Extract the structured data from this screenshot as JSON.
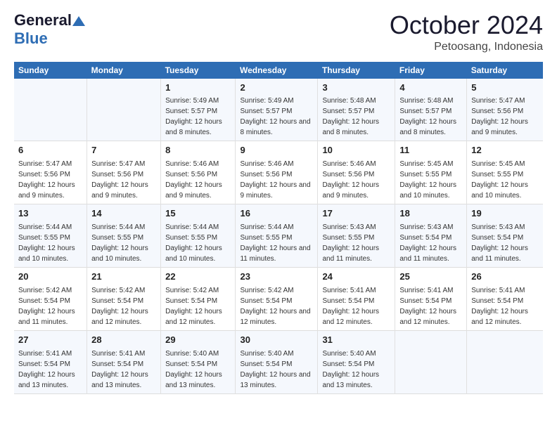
{
  "logo": {
    "general": "General",
    "blue": "Blue",
    "tagline": ""
  },
  "header": {
    "month": "October 2024",
    "location": "Petoosang, Indonesia"
  },
  "weekdays": [
    "Sunday",
    "Monday",
    "Tuesday",
    "Wednesday",
    "Thursday",
    "Friday",
    "Saturday"
  ],
  "weeks": [
    [
      {
        "day": "",
        "sunrise": "",
        "sunset": "",
        "daylight": ""
      },
      {
        "day": "",
        "sunrise": "",
        "sunset": "",
        "daylight": ""
      },
      {
        "day": "1",
        "sunrise": "Sunrise: 5:49 AM",
        "sunset": "Sunset: 5:57 PM",
        "daylight": "Daylight: 12 hours and 8 minutes."
      },
      {
        "day": "2",
        "sunrise": "Sunrise: 5:49 AM",
        "sunset": "Sunset: 5:57 PM",
        "daylight": "Daylight: 12 hours and 8 minutes."
      },
      {
        "day": "3",
        "sunrise": "Sunrise: 5:48 AM",
        "sunset": "Sunset: 5:57 PM",
        "daylight": "Daylight: 12 hours and 8 minutes."
      },
      {
        "day": "4",
        "sunrise": "Sunrise: 5:48 AM",
        "sunset": "Sunset: 5:57 PM",
        "daylight": "Daylight: 12 hours and 8 minutes."
      },
      {
        "day": "5",
        "sunrise": "Sunrise: 5:47 AM",
        "sunset": "Sunset: 5:56 PM",
        "daylight": "Daylight: 12 hours and 9 minutes."
      }
    ],
    [
      {
        "day": "6",
        "sunrise": "Sunrise: 5:47 AM",
        "sunset": "Sunset: 5:56 PM",
        "daylight": "Daylight: 12 hours and 9 minutes."
      },
      {
        "day": "7",
        "sunrise": "Sunrise: 5:47 AM",
        "sunset": "Sunset: 5:56 PM",
        "daylight": "Daylight: 12 hours and 9 minutes."
      },
      {
        "day": "8",
        "sunrise": "Sunrise: 5:46 AM",
        "sunset": "Sunset: 5:56 PM",
        "daylight": "Daylight: 12 hours and 9 minutes."
      },
      {
        "day": "9",
        "sunrise": "Sunrise: 5:46 AM",
        "sunset": "Sunset: 5:56 PM",
        "daylight": "Daylight: 12 hours and 9 minutes."
      },
      {
        "day": "10",
        "sunrise": "Sunrise: 5:46 AM",
        "sunset": "Sunset: 5:56 PM",
        "daylight": "Daylight: 12 hours and 9 minutes."
      },
      {
        "day": "11",
        "sunrise": "Sunrise: 5:45 AM",
        "sunset": "Sunset: 5:55 PM",
        "daylight": "Daylight: 12 hours and 10 minutes."
      },
      {
        "day": "12",
        "sunrise": "Sunrise: 5:45 AM",
        "sunset": "Sunset: 5:55 PM",
        "daylight": "Daylight: 12 hours and 10 minutes."
      }
    ],
    [
      {
        "day": "13",
        "sunrise": "Sunrise: 5:44 AM",
        "sunset": "Sunset: 5:55 PM",
        "daylight": "Daylight: 12 hours and 10 minutes."
      },
      {
        "day": "14",
        "sunrise": "Sunrise: 5:44 AM",
        "sunset": "Sunset: 5:55 PM",
        "daylight": "Daylight: 12 hours and 10 minutes."
      },
      {
        "day": "15",
        "sunrise": "Sunrise: 5:44 AM",
        "sunset": "Sunset: 5:55 PM",
        "daylight": "Daylight: 12 hours and 10 minutes."
      },
      {
        "day": "16",
        "sunrise": "Sunrise: 5:44 AM",
        "sunset": "Sunset: 5:55 PM",
        "daylight": "Daylight: 12 hours and 11 minutes."
      },
      {
        "day": "17",
        "sunrise": "Sunrise: 5:43 AM",
        "sunset": "Sunset: 5:55 PM",
        "daylight": "Daylight: 12 hours and 11 minutes."
      },
      {
        "day": "18",
        "sunrise": "Sunrise: 5:43 AM",
        "sunset": "Sunset: 5:54 PM",
        "daylight": "Daylight: 12 hours and 11 minutes."
      },
      {
        "day": "19",
        "sunrise": "Sunrise: 5:43 AM",
        "sunset": "Sunset: 5:54 PM",
        "daylight": "Daylight: 12 hours and 11 minutes."
      }
    ],
    [
      {
        "day": "20",
        "sunrise": "Sunrise: 5:42 AM",
        "sunset": "Sunset: 5:54 PM",
        "daylight": "Daylight: 12 hours and 11 minutes."
      },
      {
        "day": "21",
        "sunrise": "Sunrise: 5:42 AM",
        "sunset": "Sunset: 5:54 PM",
        "daylight": "Daylight: 12 hours and 12 minutes."
      },
      {
        "day": "22",
        "sunrise": "Sunrise: 5:42 AM",
        "sunset": "Sunset: 5:54 PM",
        "daylight": "Daylight: 12 hours and 12 minutes."
      },
      {
        "day": "23",
        "sunrise": "Sunrise: 5:42 AM",
        "sunset": "Sunset: 5:54 PM",
        "daylight": "Daylight: 12 hours and 12 minutes."
      },
      {
        "day": "24",
        "sunrise": "Sunrise: 5:41 AM",
        "sunset": "Sunset: 5:54 PM",
        "daylight": "Daylight: 12 hours and 12 minutes."
      },
      {
        "day": "25",
        "sunrise": "Sunrise: 5:41 AM",
        "sunset": "Sunset: 5:54 PM",
        "daylight": "Daylight: 12 hours and 12 minutes."
      },
      {
        "day": "26",
        "sunrise": "Sunrise: 5:41 AM",
        "sunset": "Sunset: 5:54 PM",
        "daylight": "Daylight: 12 hours and 12 minutes."
      }
    ],
    [
      {
        "day": "27",
        "sunrise": "Sunrise: 5:41 AM",
        "sunset": "Sunset: 5:54 PM",
        "daylight": "Daylight: 12 hours and 13 minutes."
      },
      {
        "day": "28",
        "sunrise": "Sunrise: 5:41 AM",
        "sunset": "Sunset: 5:54 PM",
        "daylight": "Daylight: 12 hours and 13 minutes."
      },
      {
        "day": "29",
        "sunrise": "Sunrise: 5:40 AM",
        "sunset": "Sunset: 5:54 PM",
        "daylight": "Daylight: 12 hours and 13 minutes."
      },
      {
        "day": "30",
        "sunrise": "Sunrise: 5:40 AM",
        "sunset": "Sunset: 5:54 PM",
        "daylight": "Daylight: 12 hours and 13 minutes."
      },
      {
        "day": "31",
        "sunrise": "Sunrise: 5:40 AM",
        "sunset": "Sunset: 5:54 PM",
        "daylight": "Daylight: 12 hours and 13 minutes."
      },
      {
        "day": "",
        "sunrise": "",
        "sunset": "",
        "daylight": ""
      },
      {
        "day": "",
        "sunrise": "",
        "sunset": "",
        "daylight": ""
      }
    ]
  ]
}
